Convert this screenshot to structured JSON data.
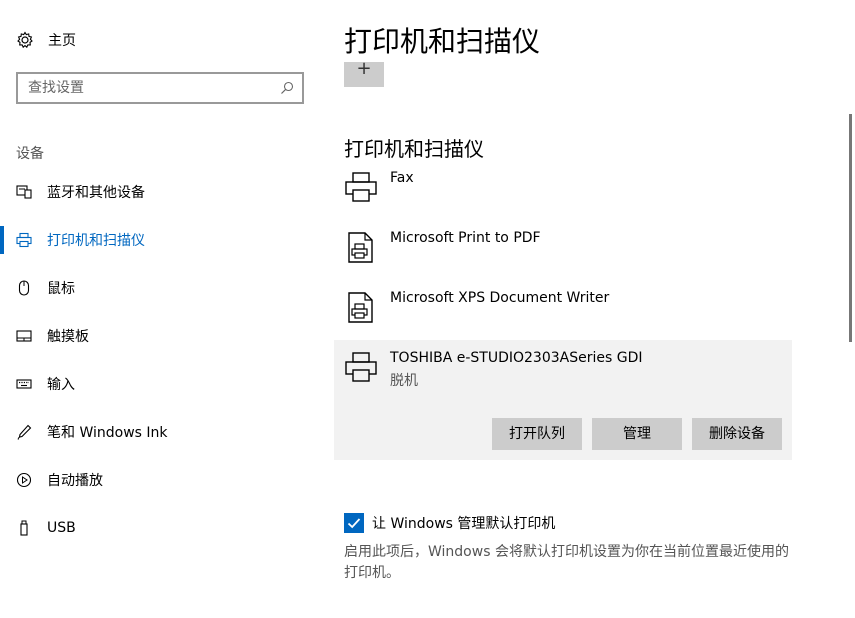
{
  "sidebar": {
    "home_label": "主页",
    "search_placeholder": "查找设置",
    "section_label": "设备",
    "items": [
      {
        "label": "蓝牙和其他设备",
        "icon": "bluetooth-devices-icon"
      },
      {
        "label": "打印机和扫描仪",
        "icon": "printer-icon",
        "active": true
      },
      {
        "label": "鼠标",
        "icon": "mouse-icon"
      },
      {
        "label": "触摸板",
        "icon": "touchpad-icon"
      },
      {
        "label": "输入",
        "icon": "keyboard-icon"
      },
      {
        "label": "笔和 Windows Ink",
        "icon": "pen-icon"
      },
      {
        "label": "自动播放",
        "icon": "autoplay-icon"
      },
      {
        "label": "USB",
        "icon": "usb-icon"
      }
    ]
  },
  "main": {
    "title": "打印机和扫描仪",
    "add_button": "+",
    "subtitle": "打印机和扫描仪",
    "printers": [
      {
        "name": "Fax",
        "icon": "fax-printer-icon"
      },
      {
        "name": "Microsoft Print to PDF",
        "icon": "document-printer-icon"
      },
      {
        "name": "Microsoft XPS Document Writer",
        "icon": "document-printer-icon"
      },
      {
        "name": "TOSHIBA e-STUDIO2303ASeries GDI",
        "status": "脱机",
        "icon": "printer-icon",
        "selected": true
      }
    ],
    "actions": {
      "open_queue": "打开队列",
      "manage": "管理",
      "remove": "删除设备"
    },
    "default_printer": {
      "label": "让 Windows 管理默认打印机",
      "checked": true,
      "description": "启用此项后，Windows 会将默认打印机设置为你在当前位置最近使用的打印机。"
    }
  },
  "colors": {
    "accent": "#0067c0",
    "button_bg": "#cccccc",
    "selected_bg": "#f2f2f2"
  }
}
